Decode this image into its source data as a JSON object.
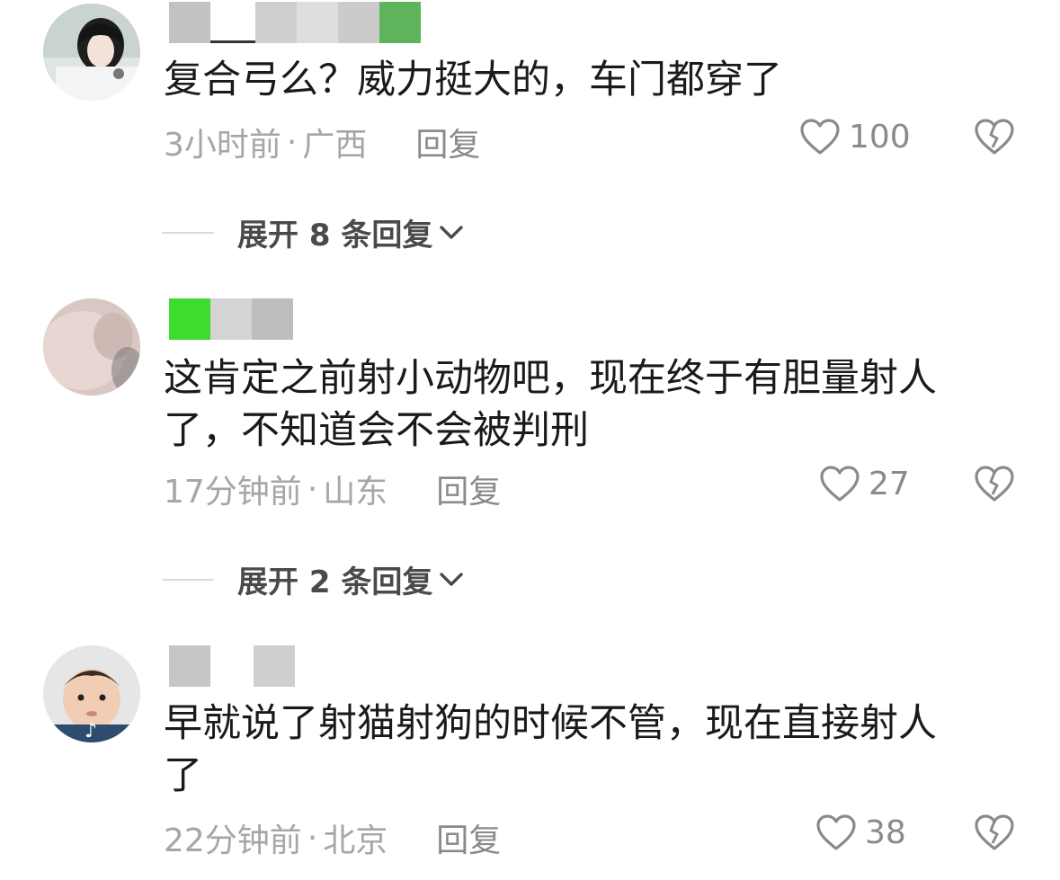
{
  "comments": [
    {
      "text": "复合弓么？威力挺大的，车门都穿了",
      "time": "3小时前",
      "sep": "·",
      "location": "广西",
      "reply_label": "回复",
      "likes": "100",
      "expand_label": "展开 8 条回复",
      "avatar_icon": "user-avatar-girl-headphones"
    },
    {
      "text": "这肯定之前射小动物吧，现在终于有胆量射人\n了，不知道会不会被判刑",
      "time": "17分钟前",
      "sep": "·",
      "location": "山东",
      "reply_label": "回复",
      "likes": "27",
      "expand_label": "展开 2 条回复",
      "avatar_icon": "user-avatar-pink-blur"
    },
    {
      "text": "早就说了射猫射狗的时候不管，现在直接射人\n了",
      "time": "22分钟前",
      "sep": "·",
      "location": "北京",
      "reply_label": "回复",
      "likes": "38",
      "avatar_icon": "user-avatar-child"
    }
  ],
  "icons": {
    "like": "heart-outline-icon",
    "dislike": "broken-heart-icon",
    "expand": "chevron-down-icon"
  },
  "colors": {
    "text": "#1a1a1a",
    "meta": "#a6a6a6",
    "icon": "#8a8a8a",
    "mask_green": "#5fb35a",
    "mask_bright_green": "#3ddc2f",
    "mask_gray": "#c6c6c6"
  }
}
